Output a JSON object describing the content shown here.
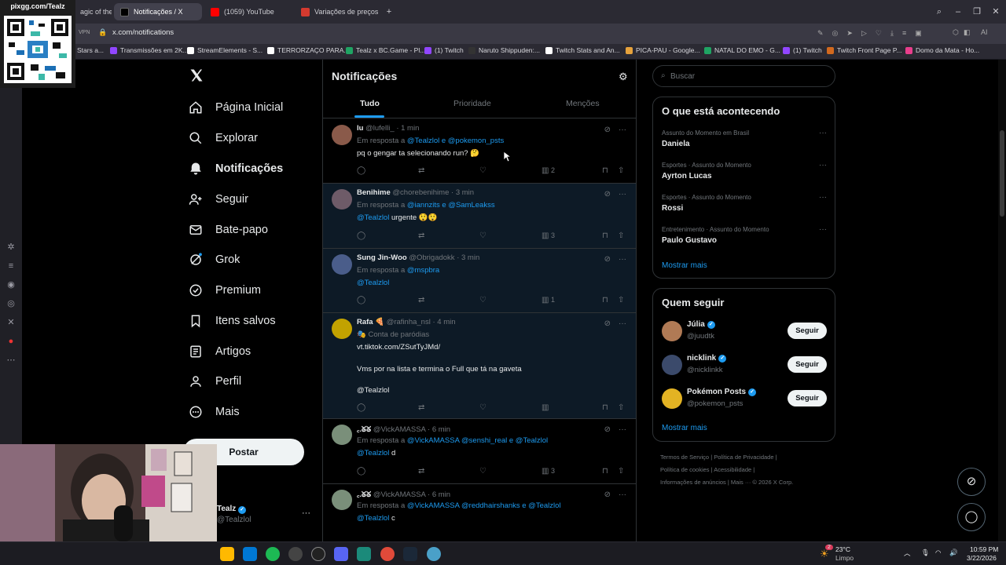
{
  "browser": {
    "tabs": [
      {
        "label": "agic of the",
        "color": "#6b6b6b"
      },
      {
        "label": "Notificações / X",
        "color": "#000000"
      },
      {
        "label": "(1059) YouTube",
        "color": "#ff0000"
      },
      {
        "label": "Variações de preços | Lig",
        "color": "#d43a2f"
      }
    ],
    "new_tab": "+",
    "vpn_label": "VPN",
    "url": "x.com/notifications",
    "ai_label": "AI",
    "bookmarks": [
      {
        "label": "Stars a...",
        "color": "#e6a23c"
      },
      {
        "label": "Transmissões em 2K...",
        "color": "#9146ff"
      },
      {
        "label": "StreamElements - S...",
        "color": "#ffffff"
      },
      {
        "label": "TERRORZAÇO PARA...",
        "color": "#ffffff"
      },
      {
        "label": "Tealz x BC.Game - Pl...",
        "color": "#1fa463"
      },
      {
        "label": "(1) Twitch",
        "color": "#9146ff"
      },
      {
        "label": "Naruto Shippuden:...",
        "color": "#333333"
      },
      {
        "label": "Twitch Stats and An...",
        "color": "#ffffff"
      },
      {
        "label": "PICA-PAU - Google...",
        "color": "#e6a23c"
      },
      {
        "label": "NATAL DO EMO - G...",
        "color": "#1fa463"
      },
      {
        "label": "(1) Twitch",
        "color": "#9146ff"
      },
      {
        "label": "Twitch Front Page P...",
        "color": "#d2691e"
      },
      {
        "label": "Domo da Mata - Ho...",
        "color": "#e83e8c"
      }
    ]
  },
  "overlay": {
    "qr_label": "pixgg.com/Tealz"
  },
  "nav": {
    "items": [
      {
        "label": "Página Inicial",
        "icon": "home-icon"
      },
      {
        "label": "Explorar",
        "icon": "search-icon"
      },
      {
        "label": "Notificações",
        "icon": "bell-icon"
      },
      {
        "label": "Seguir",
        "icon": "person-add-icon"
      },
      {
        "label": "Bate-papo",
        "icon": "mail-icon"
      },
      {
        "label": "Grok",
        "icon": "grok-icon"
      },
      {
        "label": "Premium",
        "icon": "premium-icon"
      },
      {
        "label": "Itens salvos",
        "icon": "bookmark-icon"
      },
      {
        "label": "Artigos",
        "icon": "article-icon"
      },
      {
        "label": "Perfil",
        "icon": "profile-icon"
      },
      {
        "label": "Mais",
        "icon": "more-icon"
      }
    ],
    "post_button": "Postar",
    "account": {
      "name": "Tealz",
      "handle": "@Tealzlol",
      "more": "···"
    }
  },
  "main": {
    "title": "Notificações",
    "tabs": [
      "Tudo",
      "Prioridade",
      "Menções"
    ],
    "notifications": [
      {
        "name": "lu",
        "handle": "@lufelli_",
        "time": "· 1 min",
        "reply_prefix": "Em resposta a",
        "reply_mentions": "@Tealzlol e @pokemon_psts",
        "text": "pq o gengar ta selecionando run? 🤔",
        "views": "2",
        "avatar_color": "#8a5a4a"
      },
      {
        "name": "Benihime",
        "handle": "@chorebenihime",
        "time": "· 3 min",
        "reply_prefix": "Em resposta a",
        "reply_mentions": "@iannzits e @SamLeakss",
        "mention_line": "@Tealzlol",
        "text": "urgente 😲😲",
        "views": "3",
        "avatar_color": "#6e5b68"
      },
      {
        "name": "Sung Jin-Woo",
        "handle": "@Obrigadokk",
        "time": "· 3 min",
        "reply_prefix": "Em resposta a",
        "reply_mentions": "@mspbra",
        "mention_line": "@Tealzlol",
        "text": "",
        "views": "1",
        "avatar_color": "#4a5d8a"
      },
      {
        "name": "Rafa 🍕",
        "handle": "@rafinha_nsl",
        "time": "· 4 min",
        "parody": "🎭 Conta de paródias",
        "link": "vt.tiktok.com/ZSutTyJMd/",
        "text": "Vms por na lista e termina o Full que tá na gaveta",
        "mention_line": "@Tealzlol",
        "views": "",
        "avatar_color": "#c2a200"
      },
      {
        "name": "꜀.ᘜᘜ",
        "handle": "@VickAMASSA",
        "time": "· 6 min",
        "reply_prefix": "Em resposta a",
        "reply_mentions": "@VickAMASSA @senshi_real e @Tealzlol",
        "mention_line": "@Tealzlol",
        "text": "d",
        "views": "3",
        "avatar_color": "#7a8f7a"
      },
      {
        "name": "꜀.ᘜᘜ",
        "handle": "@VickAMASSA",
        "time": "· 6 min",
        "reply_prefix": "Em resposta a",
        "reply_mentions": "@VickAMASSA @reddhairshanks e @Tealzlol",
        "mention_line": "@Tealzlol",
        "text": "c",
        "views": "",
        "avatar_color": "#7a8f7a"
      }
    ]
  },
  "right": {
    "search_placeholder": "Buscar",
    "trending_title": "O que está acontecendo",
    "trends": [
      {
        "category": "Assunto do Momento em Brasil",
        "name": "Daniela"
      },
      {
        "category": "Esportes · Assunto do Momento",
        "name": "Ayrton Lucas"
      },
      {
        "category": "Esportes · Assunto do Momento",
        "name": "Rossi"
      },
      {
        "category": "Entretenimento · Assunto do Momento",
        "name": "Paulo Gustavo"
      }
    ],
    "show_more": "Mostrar mais",
    "follow_title": "Quem seguir",
    "follow": [
      {
        "name": "Júlia",
        "handle": "@juudtk",
        "button": "Seguir",
        "avatar_color": "#b07a55"
      },
      {
        "name": "nicklink",
        "handle": "@nicklinkk",
        "button": "Seguir",
        "avatar_color": "#3b4a6b"
      },
      {
        "name": "Pokémon Posts",
        "handle": "@pokemon_psts",
        "button": "Seguir",
        "avatar_color": "#e3b323"
      }
    ],
    "footer": {
      "line1": "Termos de Serviço  |  Política de Privacidade  |",
      "line2": "Política de cookies  |  Acessibilidade  |",
      "line3": "Informações de anúncios  |  Mais ···  © 2026 X Corp."
    }
  },
  "taskbar": {
    "temperature": "23°C",
    "weather": "Limpo",
    "weather_badge": "2",
    "time": "10:59 PM",
    "date": "3/22/2026"
  }
}
